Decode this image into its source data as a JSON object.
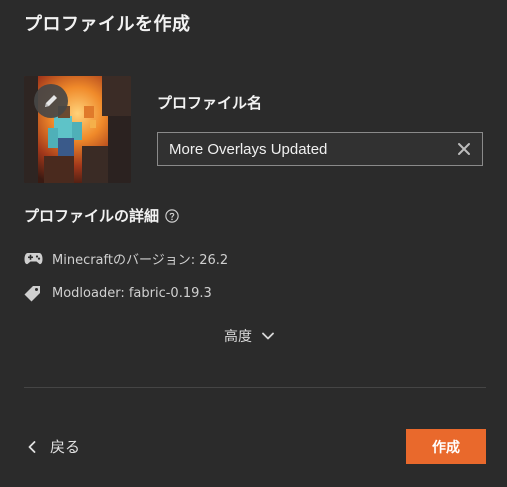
{
  "dialog": {
    "title": "プロファイルを作成"
  },
  "profile": {
    "name_label": "プロファイル名",
    "name_value": "More Overlays Updated",
    "thumbnail_icon": "pencil-icon"
  },
  "details": {
    "heading": "プロファイルの詳細",
    "help_icon": "help-circle-icon",
    "rows": [
      {
        "icon": "gamepad-icon",
        "text": "Minecraftのバージョン: 26.2"
      },
      {
        "icon": "tag-icon",
        "text": "Modloader: fabric-0.19.3"
      }
    ]
  },
  "advanced": {
    "label": "高度"
  },
  "footer": {
    "back_label": "戻る",
    "create_label": "作成"
  },
  "colors": {
    "accent": "#e9692c",
    "background": "#2b2b2b"
  }
}
